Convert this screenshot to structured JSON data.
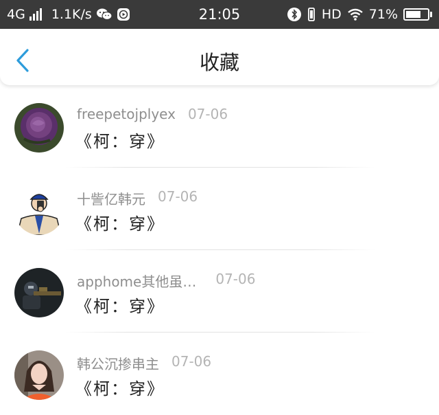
{
  "status_bar": {
    "network": "4G",
    "speed": "1.1K/s",
    "time": "21:05",
    "hd": "HD",
    "battery_percent": "71%",
    "battery_level": 0.71
  },
  "nav": {
    "title": "收藏"
  },
  "items": [
    {
      "name": "freepetojplyex",
      "date": "07-06",
      "title": "《柯：穿》"
    },
    {
      "name": "十訾亿韩元",
      "date": "07-06",
      "title": "《柯：穿》"
    },
    {
      "name": "apphome其他虽…",
      "date": "07-06",
      "title": "《柯：穿》"
    },
    {
      "name": "韩公沉掺串主",
      "date": "07-06",
      "title": "《柯：穿》"
    }
  ],
  "colors": {
    "status_bar_bg": "#3a3a3a",
    "accent_blue": "#2d9cdb",
    "name_gray": "#8e8e8e",
    "date_gray": "#b4b4b4"
  }
}
